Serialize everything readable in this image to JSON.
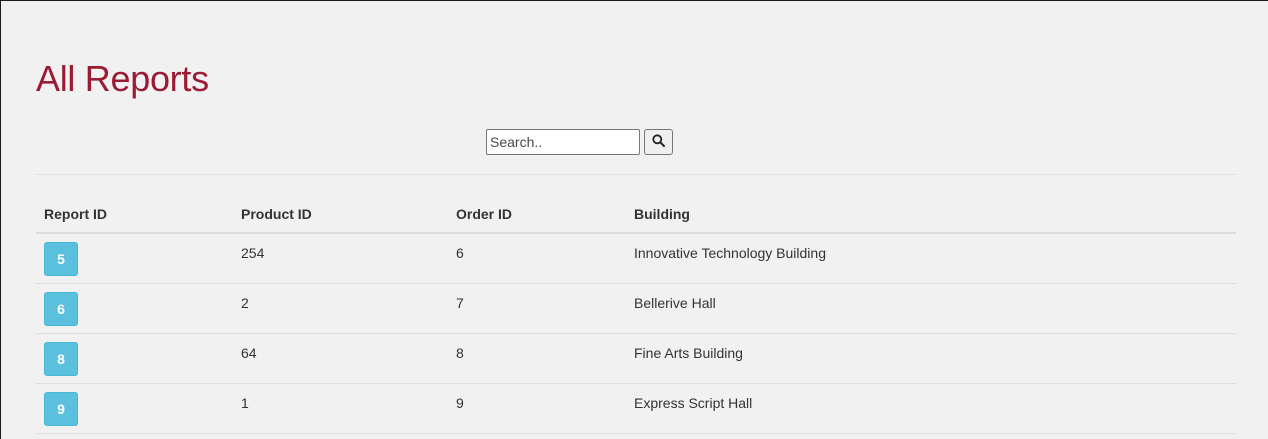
{
  "page": {
    "title": "All Reports",
    "title_color": "#9b1b34"
  },
  "search": {
    "placeholder": "Search..",
    "value": "",
    "button_icon": "search-icon"
  },
  "table": {
    "columns": [
      "Report ID",
      "Product ID",
      "Order ID",
      "Building"
    ],
    "rows": [
      {
        "report_id": "5",
        "product_id": "254",
        "order_id": "6",
        "building": "Innovative Technology Building"
      },
      {
        "report_id": "6",
        "product_id": "2",
        "order_id": "7",
        "building": "Bellerive Hall"
      },
      {
        "report_id": "8",
        "product_id": "64",
        "order_id": "8",
        "building": "Fine Arts Building"
      },
      {
        "report_id": "9",
        "product_id": "1",
        "order_id": "9",
        "building": "Express Script Hall"
      }
    ],
    "id_button_color": "#5bc0de"
  }
}
